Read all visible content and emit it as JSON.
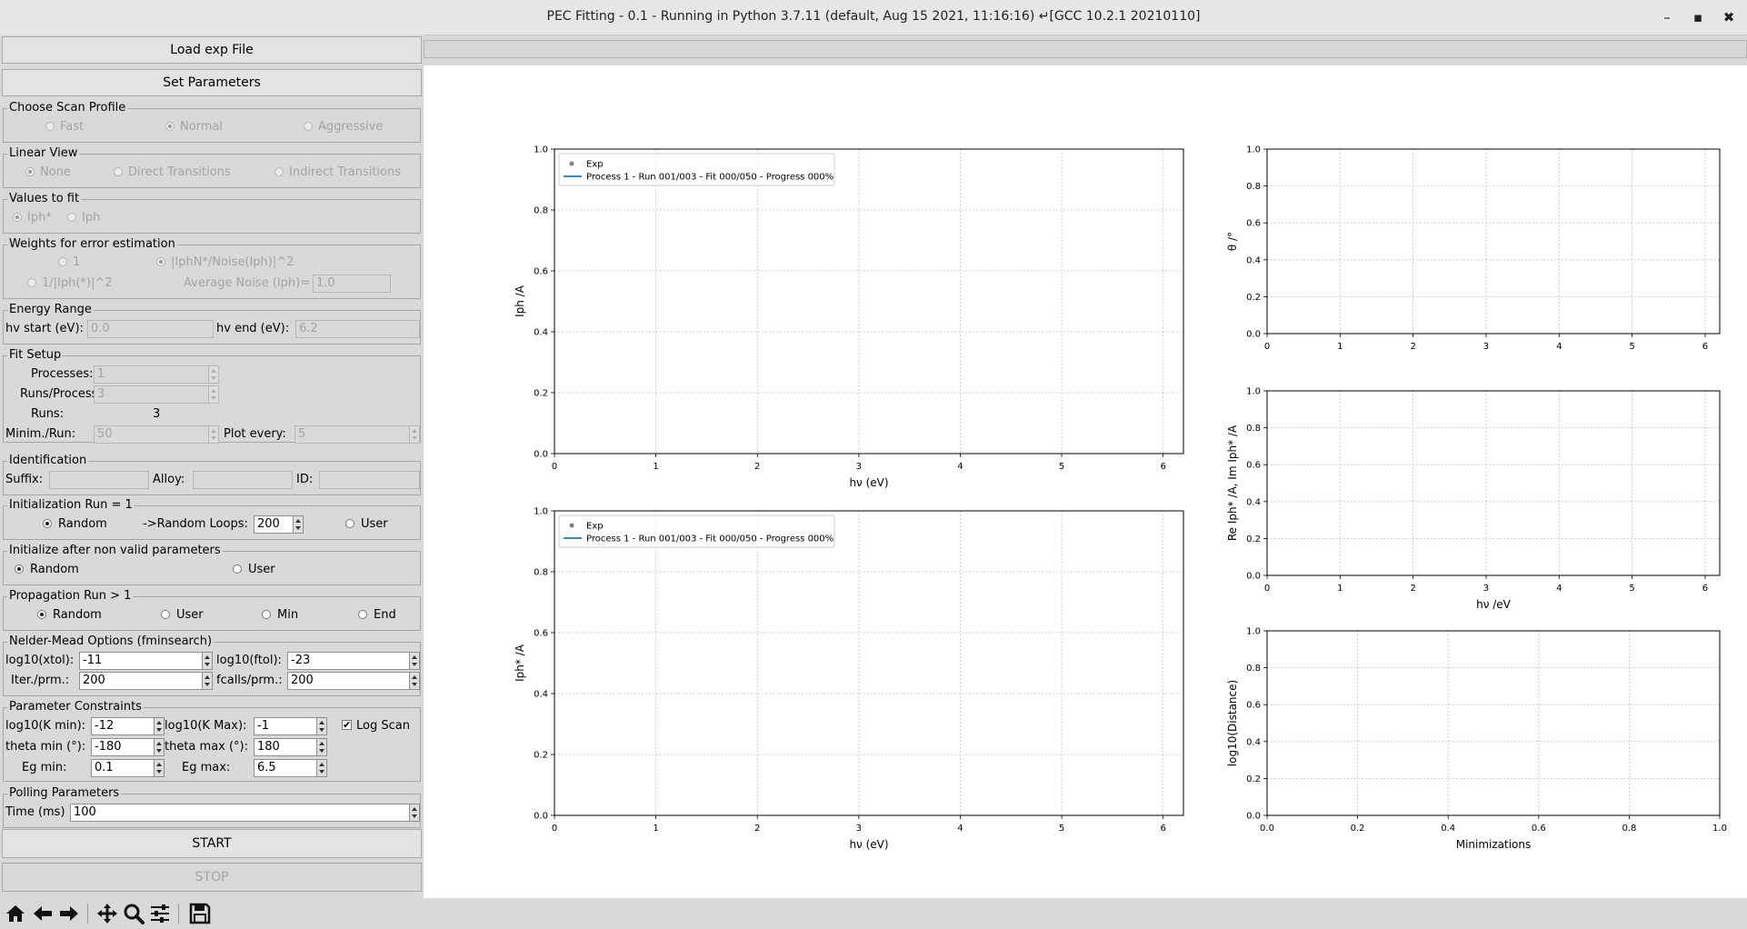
{
  "window": {
    "title": "PEC Fitting - 0.1 - Running in Python 3.7.11 (default, Aug 15 2021, 11:16:16) ↵[GCC 10.2.1 20210110]",
    "minimize_glyph": "–",
    "maximize_glyph": "▪",
    "close_glyph": "✖"
  },
  "buttons": {
    "load": "Load exp File",
    "set_params": "Set Parameters",
    "start": "START",
    "stop": "STOP"
  },
  "scan_profile": {
    "title": "Choose Scan Profile",
    "options": [
      "Fast",
      "Normal",
      "Aggressive"
    ],
    "selected": "Normal"
  },
  "linear_view": {
    "title": "Linear View",
    "options": [
      "None",
      "Direct Transitions",
      "Indirect Transitions"
    ],
    "selected": "None"
  },
  "values_to_fit": {
    "title": "Values to fit",
    "options": [
      "Iph*",
      "Iph"
    ],
    "selected": "Iph*"
  },
  "weights": {
    "title": "Weights for error estimation",
    "opt1": "1",
    "opt2": "|IphN*/Noise(Iph)|^2",
    "opt3": "1/|Iph(*)|^2",
    "noise_label": "Average Noise (Iph)=",
    "noise_value": "1.0",
    "selected": "|IphN*/Noise(Iph)|^2"
  },
  "energy_range": {
    "title": "Energy Range",
    "start_label": "hv start (eV):",
    "start_value": "0.0",
    "end_label": "hv end (eV):",
    "end_value": "6.2"
  },
  "fit_setup": {
    "title": "Fit Setup",
    "processes_label": "Processes:",
    "processes_value": "1",
    "runs_per_process_label": "Runs/Process:",
    "runs_per_process_value": "3",
    "runs_label": "Runs:",
    "runs_value": "3",
    "minim_label": "Minim./Run:",
    "minim_value": "50",
    "plot_every_label": "Plot every:",
    "plot_every_value": "5"
  },
  "identification": {
    "title": "Identification",
    "suffix_label": "Suffix:",
    "alloy_label": "Alloy:",
    "id_label": "ID:",
    "suffix_value": "",
    "alloy_value": "",
    "id_value": ""
  },
  "init_run": {
    "title": "Initialization Run = 1",
    "random": "Random",
    "loops_label": "->Random Loops:",
    "loops_value": "200",
    "user": "User",
    "selected": "Random"
  },
  "init_after": {
    "title": "Initialize after non valid parameters",
    "random": "Random",
    "user": "User",
    "selected": "Random"
  },
  "propagation": {
    "title": "Propagation Run > 1",
    "options": [
      "Random",
      "User",
      "Min",
      "End"
    ],
    "selected": "Random"
  },
  "nelder": {
    "title": "Nelder-Mead Options (fminsearch)",
    "xtol_label": "log10(xtol):",
    "xtol_value": "-11",
    "ftol_label": "log10(ftol):",
    "ftol_value": "-23",
    "iter_label": "Iter./prm.:",
    "iter_value": "200",
    "fcalls_label": "fcalls/prm.:",
    "fcalls_value": "200"
  },
  "constraints": {
    "title": "Parameter Constraints",
    "kmin_label": "log10(K min):",
    "kmin_value": "-12",
    "kmax_label": "log10(K Max):",
    "kmax_value": "-1",
    "logscan_label": "Log Scan",
    "logscan_checked": true,
    "logscan_glyph": "✔",
    "thmin_label": "theta min (°):",
    "thmin_value": "-180",
    "thmax_label": "theta max (°):",
    "thmax_value": "180",
    "egmin_label": "Eg min:",
    "egmin_value": "0.1",
    "egmax_label": "Eg max:",
    "egmax_value": "6.5"
  },
  "polling": {
    "title": "Polling Parameters",
    "time_label": "Time (ms)",
    "time_value": "100"
  },
  "toolbar_icons": [
    "home-icon",
    "back-arrow-icon",
    "forward-arrow-icon",
    "pan-icon",
    "zoom-icon",
    "configure-subplots-icon",
    "save-icon"
  ],
  "colors": {
    "series_line": "#1f77b4",
    "exp_marker": "#7f7f7f",
    "grid": "#b0b0b0"
  },
  "chart_data": [
    {
      "type": "line",
      "xlabel": "hν (eV)",
      "ylabel": "Iph /A",
      "xlim": [
        0,
        6.2
      ],
      "ylim": [
        0,
        1
      ],
      "xticks": [
        0,
        1,
        2,
        3,
        4,
        5,
        6
      ],
      "yticks": [
        0.0,
        0.2,
        0.4,
        0.6,
        0.8,
        1.0
      ],
      "grid": true,
      "legend": [
        "Exp",
        "Process 1 - Run 001/003 - Fit 000/050 - Progress 000%"
      ],
      "legend_position": "top-left",
      "series": []
    },
    {
      "type": "line",
      "xlabel": "hν (eV)",
      "ylabel": "Iph* /A",
      "xlim": [
        0,
        6.2
      ],
      "ylim": [
        0,
        1
      ],
      "xticks": [
        0,
        1,
        2,
        3,
        4,
        5,
        6
      ],
      "yticks": [
        0.0,
        0.2,
        0.4,
        0.6,
        0.8,
        1.0
      ],
      "grid": true,
      "legend": [
        "Exp",
        "Process 1 - Run 001/003 - Fit 000/050 - Progress 000%"
      ],
      "legend_position": "top-left",
      "series": []
    },
    {
      "type": "line",
      "xlabel": "",
      "ylabel": "θ /°",
      "xlim": [
        0,
        6.2
      ],
      "ylim": [
        0,
        1
      ],
      "xticks": [
        0,
        1,
        2,
        3,
        4,
        5,
        6
      ],
      "yticks": [
        0.0,
        0.2,
        0.4,
        0.6,
        0.8,
        1.0
      ],
      "grid": true,
      "series": []
    },
    {
      "type": "line",
      "xlabel": "hν /eV",
      "ylabel": "Re Iph* /A, Im Iph* /A",
      "xlim": [
        0,
        6.2
      ],
      "ylim": [
        0,
        1
      ],
      "xticks": [
        0,
        1,
        2,
        3,
        4,
        5,
        6
      ],
      "yticks": [
        0.0,
        0.2,
        0.4,
        0.6,
        0.8,
        1.0
      ],
      "grid": true,
      "series": []
    },
    {
      "type": "line",
      "xlabel": "Minimizations",
      "ylabel": "log10(Distance)",
      "xlim": [
        0,
        1
      ],
      "ylim": [
        0,
        1
      ],
      "xticks": [
        0.0,
        0.2,
        0.4,
        0.6,
        0.8,
        1.0
      ],
      "yticks": [
        0.0,
        0.2,
        0.4,
        0.6,
        0.8,
        1.0
      ],
      "grid": true,
      "series": []
    }
  ]
}
